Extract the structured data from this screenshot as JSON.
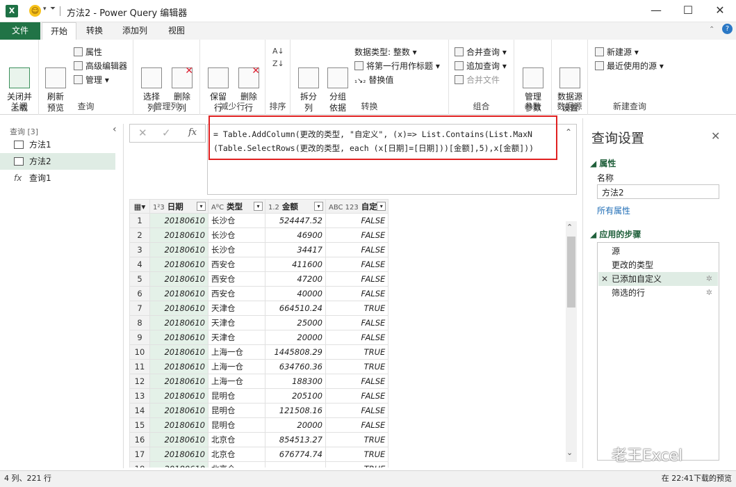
{
  "title_bar": {
    "title": "方法2 - Power Query 编辑器",
    "app_icon": "X"
  },
  "tabs": [
    {
      "label": "文件"
    },
    {
      "label": "开始"
    },
    {
      "label": "转换"
    },
    {
      "label": "添加列"
    },
    {
      "label": "视图"
    }
  ],
  "ribbon": {
    "close": {
      "btn": "关闭并\n上载",
      "group": "关闭"
    },
    "query": {
      "refresh": "刷新\n预览",
      "props": "属性",
      "adv": "高级编辑器",
      "manage": "管理",
      "group": "查询"
    },
    "cols": {
      "select": "选择\n列",
      "delete": "删除\n列",
      "group": "管理列"
    },
    "rows": {
      "keep": "保留\n行",
      "remove": "删除\n行",
      "group": "减少行"
    },
    "sort": {
      "group": "排序"
    },
    "transform": {
      "split": "拆分\n列",
      "groupby": "分组\n依据",
      "dtype": "数据类型: 整数",
      "firstrow": "将第一行用作标题",
      "replace": "替换值",
      "group": "转换"
    },
    "combine": {
      "merge": "合并查询",
      "append": "追加查询",
      "files": "合并文件",
      "group": "组合"
    },
    "params": {
      "manage": "管理\n参数",
      "group": "参数"
    },
    "datasource": {
      "settings": "数据源\n设置",
      "group": "数据源"
    },
    "newquery": {
      "newsource": "新建源",
      "recent": "最近使用的源",
      "group": "新建查询"
    }
  },
  "left_pane": {
    "header": "查询 [3]",
    "items": [
      "方法1",
      "方法2",
      "查询1"
    ]
  },
  "formula": {
    "line1": "= Table.AddColumn(更改的类型, \"自定义\", (x)=> List.Contains(List.MaxN",
    "line2": "(Table.SelectRows(更改的类型, each (x[日期]=[日期]))[金额],5),x[金额]))"
  },
  "grid": {
    "columns": [
      {
        "type": "1²3",
        "name": "日期"
      },
      {
        "type": "AᴮC",
        "name": "类型"
      },
      {
        "type": "1.2",
        "name": "金额"
      },
      {
        "type": "ABC 123",
        "name": "自定义"
      }
    ],
    "rows": [
      [
        "1",
        "20180610",
        "长沙仓",
        "524447.52",
        "FALSE"
      ],
      [
        "2",
        "20180610",
        "长沙仓",
        "46900",
        "FALSE"
      ],
      [
        "3",
        "20180610",
        "长沙仓",
        "34417",
        "FALSE"
      ],
      [
        "4",
        "20180610",
        "西安仓",
        "411600",
        "FALSE"
      ],
      [
        "5",
        "20180610",
        "西安仓",
        "47200",
        "FALSE"
      ],
      [
        "6",
        "20180610",
        "西安仓",
        "40000",
        "FALSE"
      ],
      [
        "7",
        "20180610",
        "天津仓",
        "664510.24",
        "TRUE"
      ],
      [
        "8",
        "20180610",
        "天津仓",
        "25000",
        "FALSE"
      ],
      [
        "9",
        "20180610",
        "天津仓",
        "20000",
        "FALSE"
      ],
      [
        "10",
        "20180610",
        "上海一仓",
        "1445808.29",
        "TRUE"
      ],
      [
        "11",
        "20180610",
        "上海一仓",
        "634760.36",
        "TRUE"
      ],
      [
        "12",
        "20180610",
        "上海一仓",
        "188300",
        "FALSE"
      ],
      [
        "13",
        "20180610",
        "昆明仓",
        "205100",
        "FALSE"
      ],
      [
        "14",
        "20180610",
        "昆明仓",
        "121508.16",
        "FALSE"
      ],
      [
        "15",
        "20180610",
        "昆明仓",
        "20000",
        "FALSE"
      ],
      [
        "16",
        "20180610",
        "北京仓",
        "854513.27",
        "TRUE"
      ],
      [
        "17",
        "20180610",
        "北京仓",
        "676774.74",
        "TRUE"
      ],
      [
        "18",
        "20180610",
        "北京仓",
        "",
        "TRUE"
      ]
    ]
  },
  "right_pane": {
    "title": "查询设置",
    "props_header": "属性",
    "name_label": "名称",
    "name_value": "方法2",
    "all_props": "所有属性",
    "steps_header": "应用的步骤",
    "steps": [
      "源",
      "更改的类型",
      "已添加自定义",
      "筛选的行"
    ]
  },
  "status": {
    "left": "4 列、221 行",
    "right": "在 22:41下载的预览"
  },
  "watermark": "老王Excel"
}
